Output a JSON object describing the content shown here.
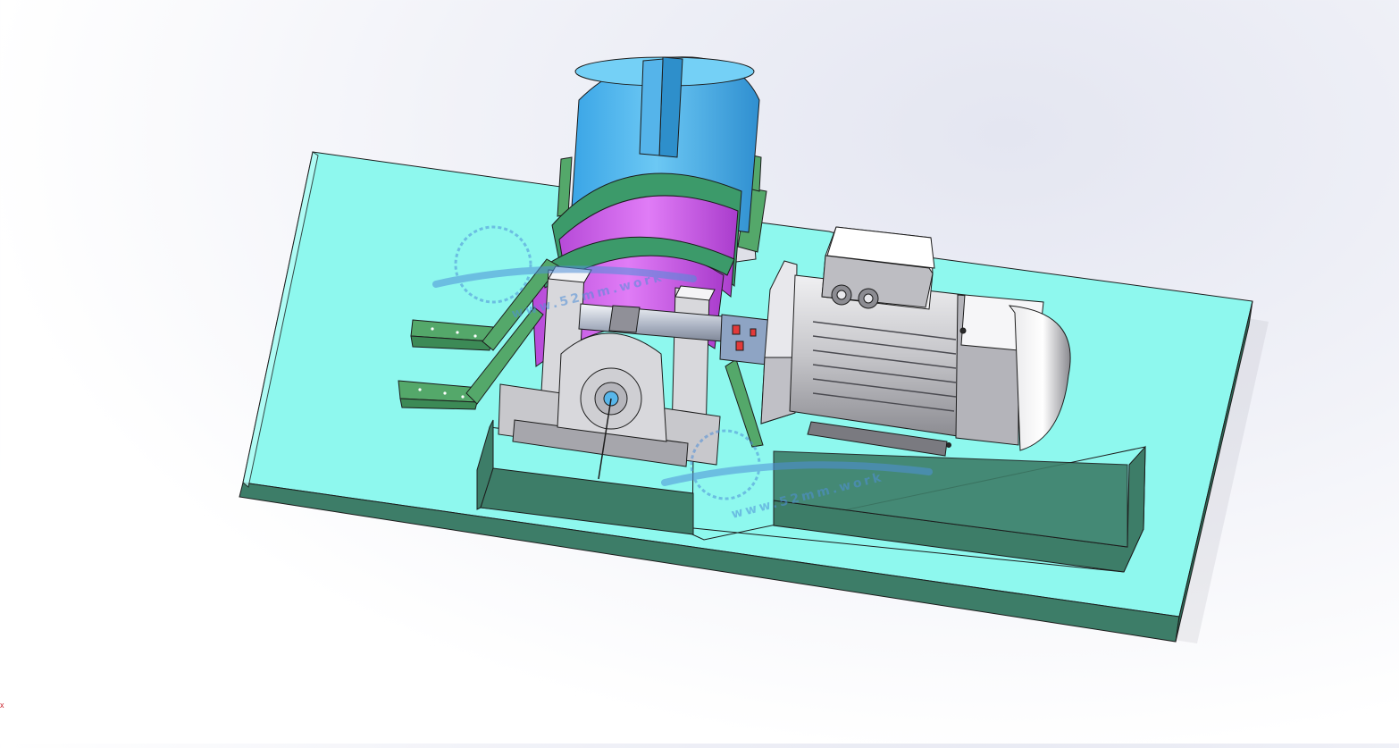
{
  "viewport": {
    "background_top": "#e4e6f1",
    "background_bottom": "#ffffff"
  },
  "model": {
    "parts": [
      "base-plate",
      "drum",
      "drum-flange-ring",
      "drum-support-brackets",
      "pillow-block-bearing",
      "shaft",
      "jaw-coupling",
      "electric-motor",
      "motor-terminal-box",
      "motor-fan-cover"
    ],
    "colors": {
      "base_top": "#8ef8ee",
      "base_side": "#3d7d68",
      "drum_body": "#5bbdf0",
      "drum_ring": "#d262f0",
      "drum_band": "#3c9a6a",
      "bracket": "#54a86a",
      "bearing": "#c8c8cc",
      "motor": "#d4d4d8",
      "coupling_accent": "#e23a3a",
      "edge": "#1c1c1c"
    }
  },
  "watermark": {
    "text": "www.52mm.work",
    "color": "#4f8fd8"
  },
  "triad": {
    "label": "x",
    "color": "#c8232c"
  }
}
